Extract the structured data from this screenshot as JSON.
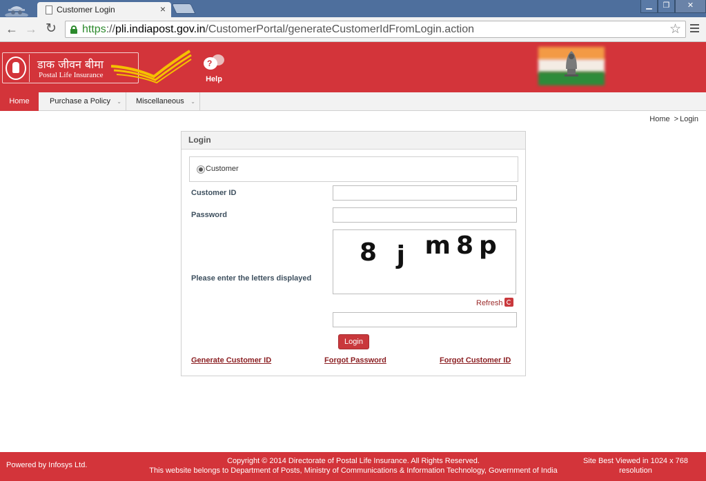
{
  "browser": {
    "tab_title": "Customer Login",
    "tab_close": "×",
    "url_scheme": "https",
    "url_sep": "://",
    "url_host": "pli.indiapost.gov.in",
    "url_path": "/CustomerPortal/generateCustomerIdFromLogin.action",
    "win_min": "▁",
    "win_max": "❐",
    "win_close": "✕",
    "nav_back": "←",
    "nav_forward": "→",
    "nav_reload": "↻",
    "bookmark_star": "☆"
  },
  "header": {
    "logo_hindi": "डाक जीवन बीमा",
    "logo_english": "Postal Life Insurance",
    "help_label": "Help",
    "help_glyph": "?"
  },
  "nav": {
    "home": "Home",
    "purchase": "Purchase a Policy",
    "misc": "Miscellaneous",
    "chevron": "⌄"
  },
  "breadcrumb": {
    "home": "Home",
    "sep": ">",
    "current": "Login"
  },
  "login": {
    "title": "Login",
    "user_type": "Customer",
    "customer_id_label": "Customer ID",
    "customer_id_value": "",
    "password_label": "Password",
    "password_value": "",
    "captcha_label": "Please enter the letters displayed",
    "captcha_chars": [
      "8",
      "j",
      "m8p"
    ],
    "captcha_value": "",
    "refresh_label": "Refresh",
    "login_button": "Login",
    "link_generate": "Generate Customer ID",
    "link_forgot_password": "Forgot Password",
    "link_forgot_customer_id": "Forgot Customer ID"
  },
  "footer": {
    "powered_by": "Powered by Infosys Ltd.",
    "copyright": "Copyright © 2014 Directorate of Postal Life Insurance. All Rights Reserved.",
    "ownership": "This website belongs to Department of Posts, Ministry of Communications & Information Technology, Government of India",
    "best_viewed_1": "Site Best Viewed in 1024 x 768",
    "best_viewed_2": "resolution"
  },
  "colors": {
    "brand_red": "#d3343a",
    "link_red": "#8b1f22",
    "secure_green": "#2d8a2d"
  }
}
